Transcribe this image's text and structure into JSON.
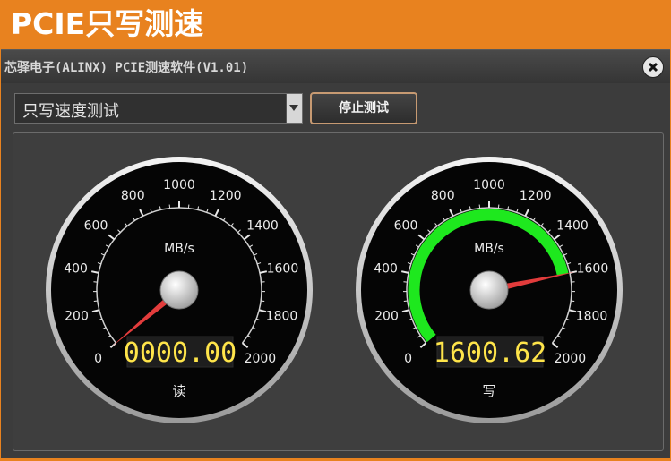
{
  "banner": {
    "title": "PCIE只写测速"
  },
  "window": {
    "title": "芯驿电子(ALINX) PCIE测速软件(V1.01)"
  },
  "controls": {
    "mode_selected": "只写速度测试",
    "stop_label": "停止测试"
  },
  "gauges": [
    {
      "unit": "MB/s",
      "label": "读",
      "readout": "0000.00",
      "value": 0,
      "min": 0,
      "max": 2000,
      "ticks": [
        "0",
        "200",
        "400",
        "600",
        "800",
        "1000",
        "1200",
        "1400",
        "1600",
        "1800",
        "2000"
      ]
    },
    {
      "unit": "MB/s",
      "label": "写",
      "readout": "1600.62",
      "value": 1600.62,
      "min": 0,
      "max": 2000,
      "ticks": [
        "0",
        "200",
        "400",
        "600",
        "800",
        "1000",
        "1200",
        "1400",
        "1600",
        "1800",
        "2000"
      ]
    }
  ],
  "colors": {
    "banner": "#e8821f",
    "arc": "#1ee81e",
    "needle": "#e23c3c",
    "readout": "#ffe54a"
  }
}
